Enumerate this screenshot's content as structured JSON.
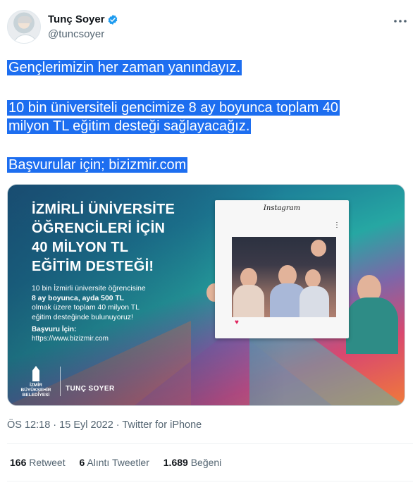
{
  "author": {
    "name": "Tunç Soyer",
    "handle": "@tuncsoyer"
  },
  "tweet": {
    "lines": [
      "Gençlerimizin her zaman yanındayız.",
      "10 bin üniversiteli gencimize 8 ay boyunca toplam 40",
      "milyon TL eğitim desteği sağlayacağız.",
      "Başvurular için; bizizmir.com"
    ]
  },
  "media": {
    "headline": [
      "İZMİRLİ ÜNİVERSİTE",
      "ÖĞRENCİLERİ İÇİN",
      "40 MİLYON TL",
      "EĞİTİM DESTEĞİ!"
    ],
    "body": [
      "10 bin İzmirli üniversite öğrencisine",
      "8 ay boyunca, ayda 500 TL",
      "olmak üzere toplam 40 milyon TL",
      "eğitim desteğinde bulunuyoruz!"
    ],
    "apply_label": "Başvuru İçin:",
    "apply_url": "https://www.bizizmir.com",
    "frame_label": "Instagram",
    "logo_text": [
      "İZMİR",
      "BÜYÜKŞEHİR",
      "BELEDİYESİ"
    ],
    "signature": "TUNÇ SOYER"
  },
  "meta": {
    "time": "ÖS 12:18",
    "date": "15 Eyl 2022",
    "source": "Twitter for iPhone",
    "separator": "·"
  },
  "stats": {
    "retweets_count": "166",
    "retweets_label": "Retweet",
    "quotes_count": "6",
    "quotes_label": "Alıntı Tweetler",
    "likes_count": "1.689",
    "likes_label": "Beğeni"
  },
  "colors": {
    "verified": "#1d9bf0",
    "selection": "#1d6ef0",
    "secondary_text": "#536471"
  }
}
